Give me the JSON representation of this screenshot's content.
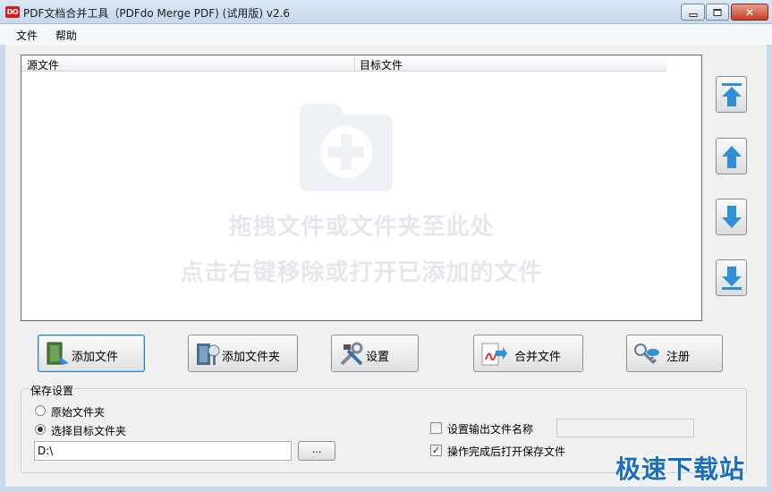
{
  "window": {
    "icon_text": "DO",
    "title": "PDF文档合并工具（PDFdo Merge PDF) (试用版) v2.6",
    "close_glyph": "✕"
  },
  "menu": [
    {
      "label": "文件"
    },
    {
      "label": "帮助"
    }
  ],
  "file_list": {
    "columns": [
      "源文件",
      "目标文件"
    ],
    "rows": [],
    "empty_hint_line1": "拖拽文件或文件夹至此处",
    "empty_hint_line2": "点击右键移除或打开已添加的文件",
    "empty_icon": "folder-plus-icon"
  },
  "reorder_buttons": [
    {
      "name": "move-to-top",
      "icon": "arrow-top-icon"
    },
    {
      "name": "move-up",
      "icon": "arrow-up-icon"
    },
    {
      "name": "move-down",
      "icon": "arrow-down-icon"
    },
    {
      "name": "move-to-bottom",
      "icon": "arrow-bottom-icon"
    }
  ],
  "actions": [
    {
      "label": "添加文件",
      "icon": "add-file-icon"
    },
    {
      "label": "添加文件夹",
      "icon": "add-folder-icon"
    },
    {
      "label": "设置",
      "icon": "settings-tools-icon"
    },
    {
      "label": "合并文件",
      "icon": "merge-pdf-icon"
    },
    {
      "label": "注册",
      "icon": "register-key-icon"
    }
  ],
  "save_settings": {
    "title": "保存设置",
    "options": [
      {
        "label": "原始文件夹",
        "selected": false
      },
      {
        "label": "选择目标文件夹",
        "selected": true
      }
    ],
    "target_path": "D:\\",
    "browse_label": "...",
    "set_output_name": {
      "label": "设置输出文件名称",
      "checked": false,
      "value": ""
    },
    "open_after_complete": {
      "label": "操作完成后打开保存文件",
      "checked": true
    }
  },
  "check_glyph": "✓",
  "watermark": "极速下载站",
  "colors": {
    "titlebar": "#c6d8ec",
    "accent_blue": "#2f8fd8",
    "watermark": "#1a6ec0"
  }
}
